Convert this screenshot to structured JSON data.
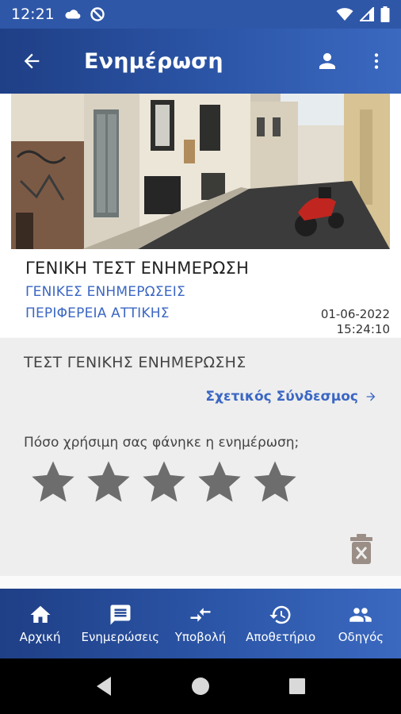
{
  "status_bar": {
    "time": "12:21",
    "icons": [
      "cloud-icon",
      "sync-disabled-icon",
      "wifi-icon",
      "signal-icon",
      "battery-icon"
    ]
  },
  "app_bar": {
    "title": "Ενημέρωση",
    "icons": [
      "back-arrow-icon",
      "account-icon",
      "more-vert-icon"
    ]
  },
  "article": {
    "image": "street-photo",
    "title": "ΓΕΝΙΚΗ ΤΕΣΤ ΕΝΗΜΕΡΩΣΗ",
    "category": "ΓΕΝΙΚΕΣ ΕΝΗΜΕΡΩΣΕΙΣ",
    "region": "ΠΕΡΙΦΕΡΕΙΑ ΑΤΤΙΚΗΣ",
    "date": "01-06-2022",
    "time": "15:24:10",
    "body": "ΤΕΣΤ ΓΕΝΙΚΗΣ ΕΝΗΜΕΡΩΣΗΣ",
    "related_link": "Σχετικός Σύνδεσμος",
    "rating_question": "Πόσο χρήσιμη σας φάνηκε η ενημέρωση;",
    "rating": {
      "value": 0,
      "max": 5
    }
  },
  "bottom_nav": {
    "items": [
      {
        "label": "Αρχική",
        "icon": "home-icon"
      },
      {
        "label": "Ενημερώσεις",
        "icon": "message-icon"
      },
      {
        "label": "Υποβολή",
        "icon": "compare-arrows-icon"
      },
      {
        "label": "Αποθετήριο",
        "icon": "history-icon"
      },
      {
        "label": "Οδηγός",
        "icon": "people-icon"
      }
    ]
  },
  "system_nav": {
    "icons": [
      "back-triangle-icon",
      "home-circle-icon",
      "recents-square-icon"
    ]
  },
  "colors": {
    "primary": "#2c56a8",
    "primary_dark": "#1f3f86",
    "link": "#3b67c4",
    "star": "#6d6d6d",
    "content_bg": "#eeeeee"
  }
}
